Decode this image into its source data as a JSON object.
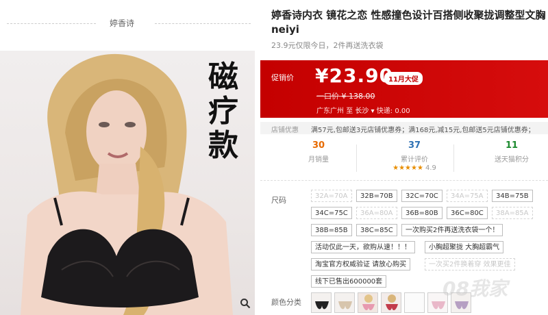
{
  "brand": {
    "name": "婷香诗"
  },
  "image": {
    "overlay_text": [
      "磁",
      "疗",
      "款"
    ],
    "zoom_icon": "magnifier-icon"
  },
  "product": {
    "title_line1": "婷香诗内衣 镜花之恋 性感撞色设计百搭侧收聚拢调整型文胸",
    "title_line2": "neiyi",
    "subtitle": "23.9元仅限今日，2件再送洗衣袋"
  },
  "promo": {
    "label": "促销价",
    "price": "¥23.90",
    "badge": "11月大促",
    "old_label": "一口价",
    "old_price": "¥ 138.00",
    "origin": "广东广州",
    "to": "至",
    "dest": "长沙",
    "shipping_label": "快递:",
    "shipping_value": "0.00",
    "colors": {
      "bg": "#c40000",
      "text": "#ffffff"
    }
  },
  "coupon": {
    "label": "店铺优惠",
    "text": "满57元,包邮送3元店铺优惠券；满168元,减15元,包邮送5元店铺优惠券；"
  },
  "stats": [
    {
      "value": "30",
      "label": "月销量"
    },
    {
      "value": "37",
      "label": "累计评价",
      "rating_stars": "★★★★★",
      "rating": "4.9"
    },
    {
      "value": "11",
      "label": "送天猫积分"
    }
  ],
  "sizes": {
    "label": "尺码",
    "options": [
      {
        "text": "32A=70A",
        "disabled": true
      },
      {
        "text": "32B=70B",
        "disabled": false
      },
      {
        "text": "32C=70C",
        "disabled": false
      },
      {
        "text": "34A=75A",
        "disabled": true
      },
      {
        "text": "34B=75B",
        "disabled": false
      },
      {
        "text": "34C=75C",
        "disabled": false
      },
      {
        "text": "36A=80A",
        "disabled": true
      },
      {
        "text": "36B=80B",
        "disabled": false
      },
      {
        "text": "36C=80C",
        "disabled": false
      },
      {
        "text": "38A=85A",
        "disabled": true
      },
      {
        "text": "38B=85B",
        "disabled": false
      },
      {
        "text": "38C=85C",
        "disabled": false
      },
      {
        "text": "一次购买2件再送洗衣袋一个！",
        "disabled": false
      },
      {
        "text": "活动仅此一天，欲购从速！！！",
        "disabled": false
      },
      {
        "text": "小胸超聚拢 大胸超霸气",
        "disabled": false
      },
      {
        "text": "淘宝官方权威验证 请放心购买",
        "disabled": false
      },
      {
        "text": "一次买2件换着穿 效果更佳",
        "disabled": true
      },
      {
        "text": "线下已售出600000套",
        "disabled": false
      }
    ]
  },
  "colors_section": {
    "label": "颜色分类"
  },
  "watermark": "08我家"
}
